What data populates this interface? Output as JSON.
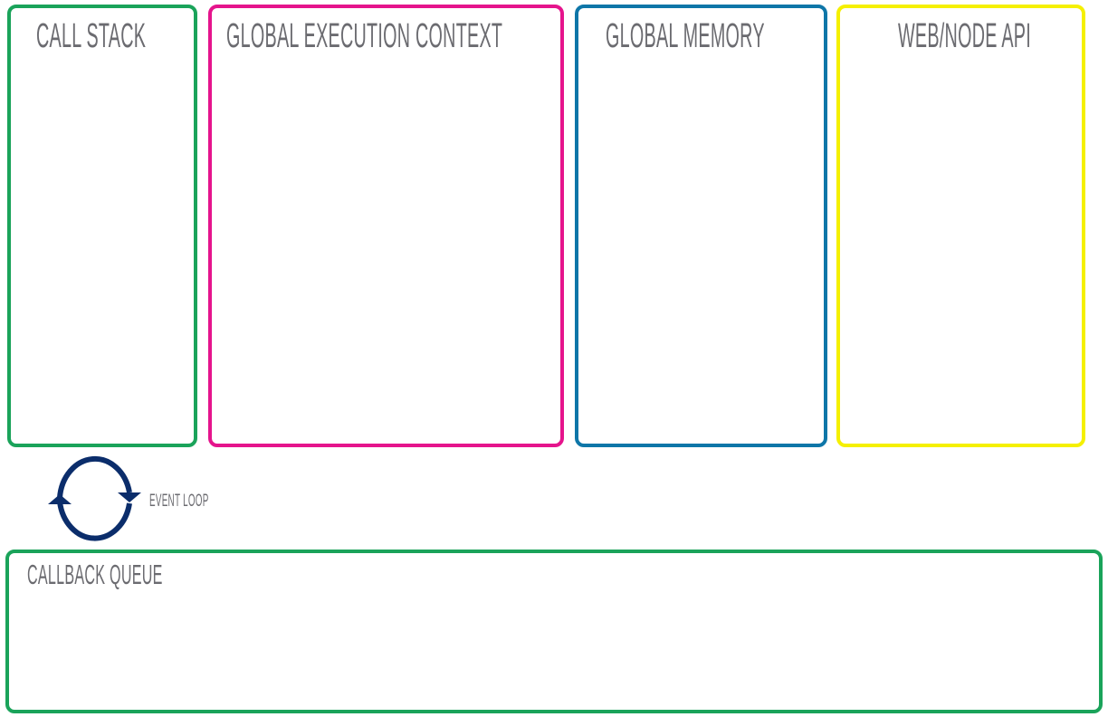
{
  "panels": {
    "call_stack": {
      "title": "CALL STACK",
      "color": "#1aa35a"
    },
    "global_execution_context": {
      "title": "GLOBAL EXECUTION CONTEXT",
      "color": "#e5148c"
    },
    "global_memory": {
      "title": "GLOBAL MEMORY",
      "color": "#0e76a8"
    },
    "web_node_api": {
      "title": "WEB/NODE API",
      "color": "#f5f000"
    },
    "callback_queue": {
      "title": "CALLBACK QUEUE",
      "color": "#1aa35a"
    }
  },
  "event_loop": {
    "label": "EVENT LOOP",
    "icon": "refresh-cycle-icon",
    "color": "#0b2d6b"
  }
}
